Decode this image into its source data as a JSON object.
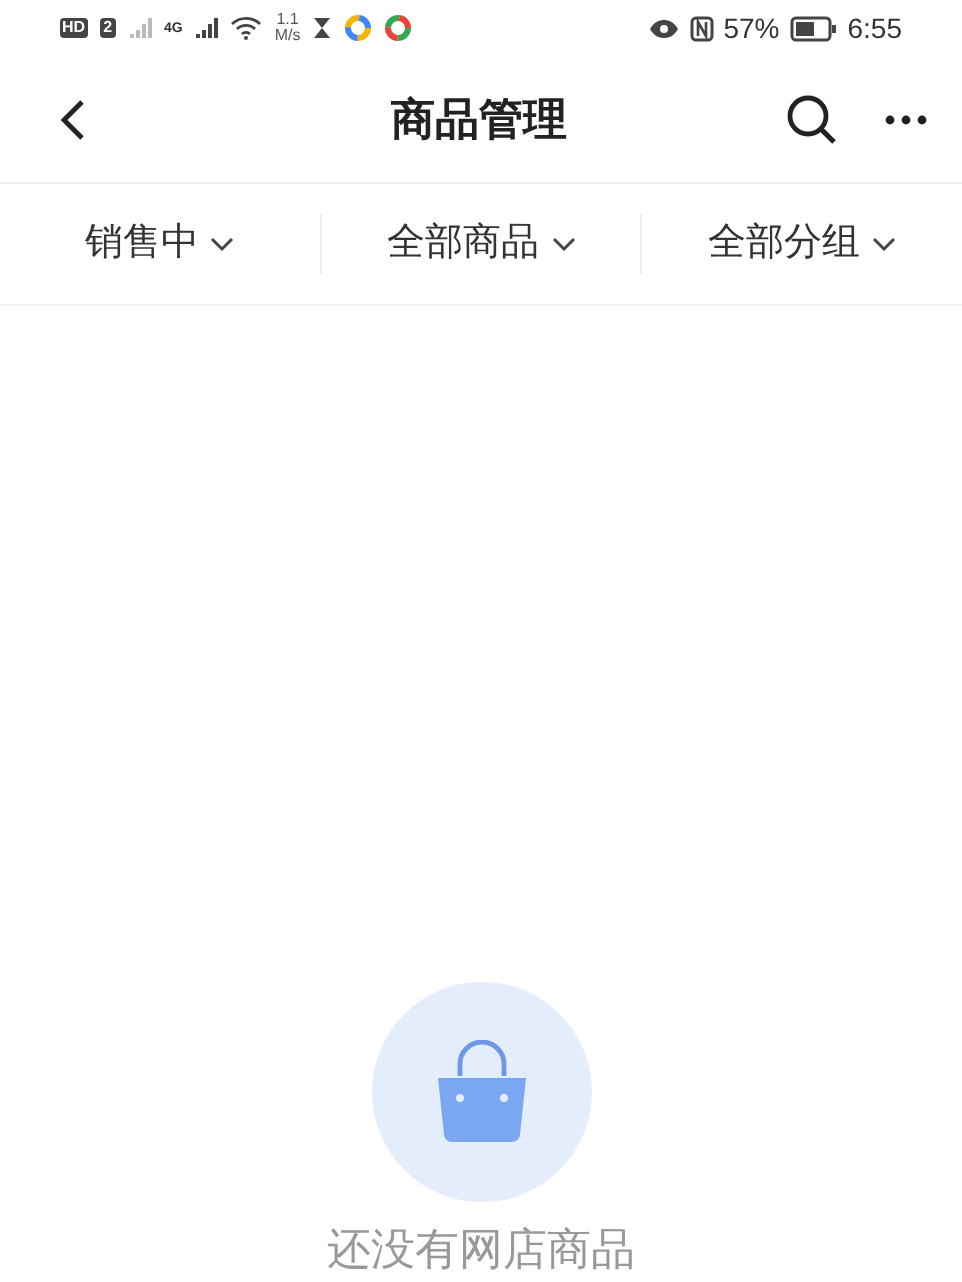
{
  "status_bar": {
    "hd": "HD",
    "sim": "2",
    "network": "4G",
    "speed_value": "1.1",
    "speed_unit": "M/s",
    "battery": "57%",
    "time": "6:55"
  },
  "header": {
    "title": "商品管理"
  },
  "filters": [
    {
      "label": "销售中"
    },
    {
      "label": "全部商品"
    },
    {
      "label": "全部分组"
    }
  ],
  "empty_state": {
    "message": "还没有网店商品"
  }
}
